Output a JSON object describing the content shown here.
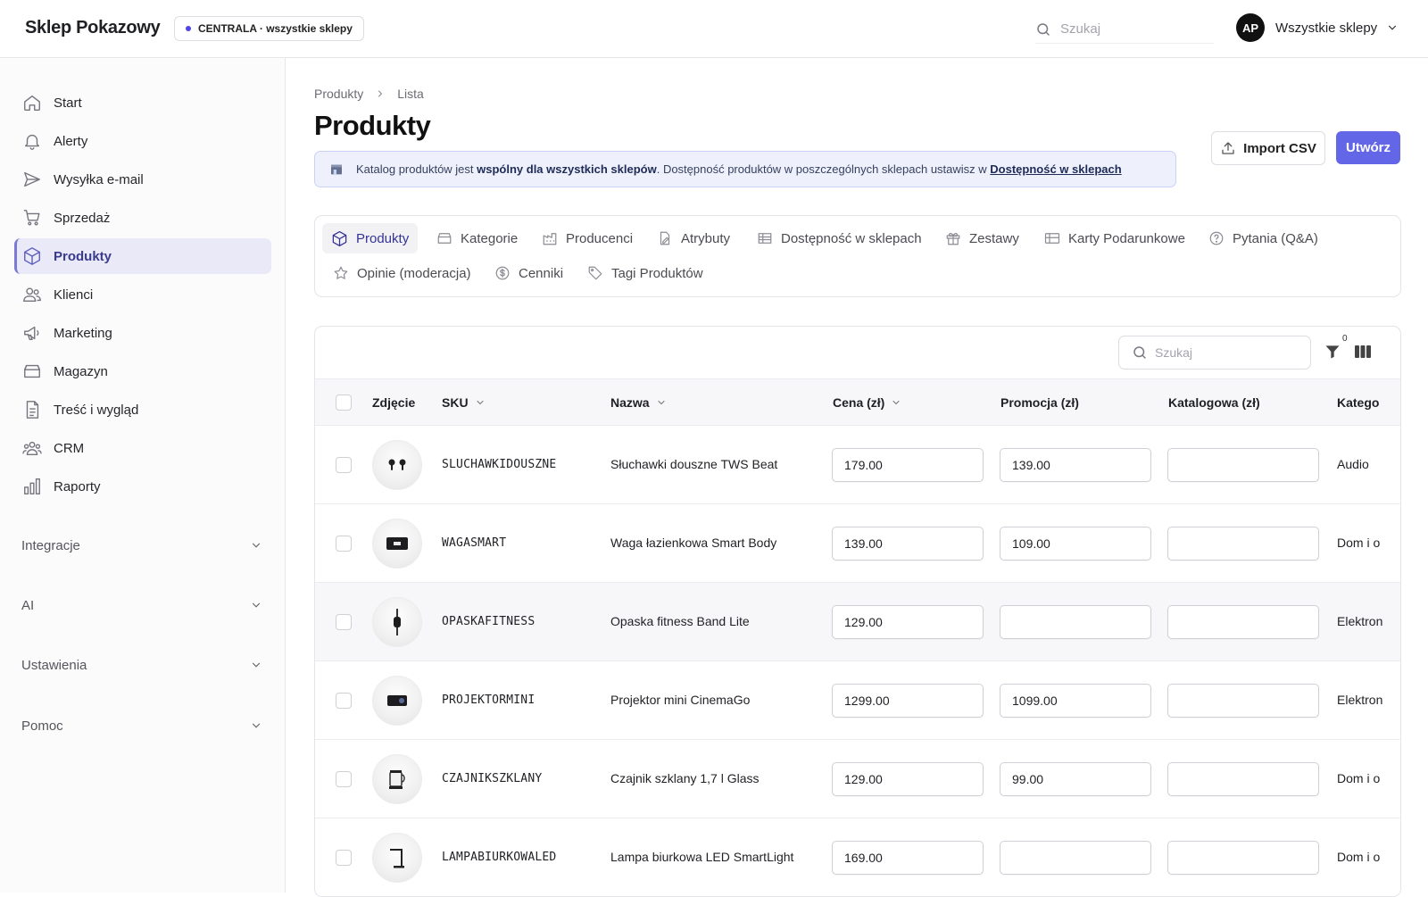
{
  "header": {
    "brand": "Sklep Pokazowy",
    "store_badge": "CENTRALA · wszystkie sklepy",
    "search_placeholder": "Szukaj",
    "user_initials": "AP",
    "store_selector": "Wszystkie sklepy"
  },
  "sidebar": {
    "items": [
      {
        "label": "Start",
        "icon": "home-icon"
      },
      {
        "label": "Alerty",
        "icon": "bell-icon"
      },
      {
        "label": "Wysyłka e-mail",
        "icon": "send-icon"
      },
      {
        "label": "Sprzedaż",
        "icon": "cart-icon"
      },
      {
        "label": "Produkty",
        "icon": "box-icon",
        "active": true
      },
      {
        "label": "Klienci",
        "icon": "users-icon"
      },
      {
        "label": "Marketing",
        "icon": "megaphone-icon"
      },
      {
        "label": "Magazyn",
        "icon": "archive-icon"
      },
      {
        "label": "Treść i wygląd",
        "icon": "document-icon"
      },
      {
        "label": "CRM",
        "icon": "group-icon"
      },
      {
        "label": "Raporty",
        "icon": "bar-chart-icon"
      }
    ],
    "sections": [
      "Integracje",
      "AI",
      "Ustawienia",
      "Pomoc"
    ]
  },
  "breadcrumb": [
    "Produkty",
    "Lista"
  ],
  "page_title": "Produkty",
  "info": {
    "prefix": "Katalog produktów jest ",
    "bold": "wspólny dla wszystkich sklepów",
    "middle": ". Dostępność produktów w poszczególnych sklepach ustawisz w ",
    "link": "Dostępność w sklepach"
  },
  "actions": {
    "import": "Import CSV",
    "create": "Utwórz"
  },
  "tabs": [
    {
      "label": "Produkty",
      "icon": "box-icon",
      "active": true
    },
    {
      "label": "Kategorie",
      "icon": "folder-icon"
    },
    {
      "label": "Producenci",
      "icon": "factory-icon"
    },
    {
      "label": "Atrybuty",
      "icon": "attributes-icon"
    },
    {
      "label": "Dostępność w sklepach",
      "icon": "table-icon"
    },
    {
      "label": "Zestawy",
      "icon": "gift-icon"
    },
    {
      "label": "Karty Podarunkowe",
      "icon": "gift-card-icon"
    },
    {
      "label": "Pytania (Q&A)",
      "icon": "question-icon"
    },
    {
      "label": "Opinie (moderacja)",
      "icon": "star-icon"
    },
    {
      "label": "Cenniki",
      "icon": "dollar-icon"
    },
    {
      "label": "Tagi Produktów",
      "icon": "tag-icon"
    }
  ],
  "table": {
    "search_placeholder": "Szukaj",
    "filter_count": "0",
    "columns": [
      "Zdjęcie",
      "SKU",
      "Nazwa",
      "Cena (zł)",
      "Promocja (zł)",
      "Katalogowa (zł)",
      "Katego"
    ],
    "rows": [
      {
        "sku": "SLUCHAWKIDOUSZNE",
        "name": "Słuchawki douszne TWS Beat",
        "price": "179.00",
        "promo": "139.00",
        "catalog": "",
        "category": "Audio",
        "thumb": "earbuds"
      },
      {
        "sku": "WAGASMART",
        "name": "Waga łazienkowa Smart Body",
        "price": "139.00",
        "promo": "109.00",
        "catalog": "",
        "category": "Dom i o",
        "thumb": "scale"
      },
      {
        "sku": "OPASKAFITNESS",
        "name": "Opaska fitness Band Lite",
        "price": "129.00",
        "promo": "",
        "catalog": "",
        "category": "Elektron",
        "thumb": "band"
      },
      {
        "sku": "PROJEKTORMINI",
        "name": "Projektor mini CinemaGo",
        "price": "1299.00",
        "promo": "1099.00",
        "catalog": "",
        "category": "Elektron",
        "thumb": "projector"
      },
      {
        "sku": "CZAJNIKSZKLANY",
        "name": "Czajnik szklany 1,7 l Glass",
        "price": "129.00",
        "promo": "99.00",
        "catalog": "",
        "category": "Dom i o",
        "thumb": "kettle"
      },
      {
        "sku": "LAMPABIURKOWALED",
        "name": "Lampa biurkowa LED SmartLight",
        "price": "169.00",
        "promo": "",
        "catalog": "",
        "category": "Dom i o",
        "thumb": "lamp"
      }
    ]
  }
}
